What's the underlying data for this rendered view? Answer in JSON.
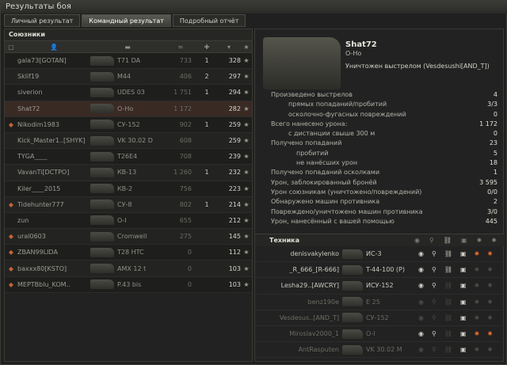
{
  "window": {
    "title": "Результаты боя"
  },
  "tabs": [
    "Личный результат",
    "Командный результат",
    "Подробный отчёт"
  ],
  "allies": {
    "title": "Союзники",
    "rows": [
      {
        "name": "gala73[GOTAN]",
        "vehicle": "T71 DA",
        "damage": "733",
        "kills": "1",
        "xp": "328"
      },
      {
        "name": "Sklif19",
        "vehicle": "M44",
        "damage": "406",
        "kills": "2",
        "xp": "297"
      },
      {
        "name": "siverion",
        "vehicle": "UDES 03",
        "damage": "1 751",
        "kills": "1",
        "xp": "294"
      },
      {
        "name": "Shat72",
        "vehicle": "O-Ho",
        "damage": "1 172",
        "kills": "",
        "xp": "282",
        "me": true
      },
      {
        "name": "Nikodim1983",
        "vehicle": "СУ-152",
        "damage": "902",
        "kills": "1",
        "xp": "259",
        "platoon": true
      },
      {
        "name": "Kick_Master1..[SHYK]",
        "vehicle": "VK 30.02 D",
        "damage": "608",
        "kills": "",
        "xp": "259"
      },
      {
        "name": "TYGA____",
        "vehicle": "T26E4",
        "damage": "708",
        "kills": "",
        "xp": "239"
      },
      {
        "name": "VavanTi[DCTPO]",
        "vehicle": "КВ-13",
        "damage": "1 260",
        "kills": "1",
        "xp": "232"
      },
      {
        "name": "Kiler____2015",
        "vehicle": "КВ-2",
        "damage": "756",
        "kills": "",
        "xp": "223"
      },
      {
        "name": "Tidehunter777",
        "vehicle": "СУ-8",
        "damage": "802",
        "kills": "1",
        "xp": "214",
        "platoon": true
      },
      {
        "name": "zun",
        "vehicle": "O-I",
        "damage": "655",
        "kills": "",
        "xp": "212"
      },
      {
        "name": "ural0603",
        "vehicle": "Cromwell",
        "damage": "275",
        "kills": "",
        "xp": "145",
        "platoon": true
      },
      {
        "name": "ZBAN99LIDA",
        "vehicle": "T28 HTC",
        "damage": "0",
        "kills": "",
        "xp": "112",
        "platoon": true
      },
      {
        "name": "baxxx80[KSTO]",
        "vehicle": "AMX 12 t",
        "damage": "0",
        "kills": "",
        "xp": "103",
        "platoon": true
      },
      {
        "name": "MEPTBblu_KOM..",
        "vehicle": "P.43 bis",
        "damage": "0",
        "kills": "",
        "xp": "103",
        "platoon": true
      }
    ]
  },
  "vehicle": {
    "name": "Shat72",
    "type": "O-Ho",
    "death": "Уничтожен выстрелом (Vesdesushi[AND_T])"
  },
  "stats": [
    {
      "label": "Произведено выстрелов",
      "value": "4",
      "indent": 0
    },
    {
      "label": "прямых попаданий/пробитий",
      "value": "3/3",
      "indent": 1
    },
    {
      "label": "осколочно-фугасных повреждений",
      "value": "0",
      "indent": 1
    },
    {
      "label": "Всего нанесено урона:",
      "value": "1 172",
      "indent": 0
    },
    {
      "label": "с дистанции свыше 300 м",
      "value": "0",
      "indent": 1
    },
    {
      "label": "Получено попаданий",
      "value": "23",
      "indent": 0
    },
    {
      "label": "пробитий",
      "value": "5",
      "indent": 2
    },
    {
      "label": "не нанёсших урон",
      "value": "18",
      "indent": 2
    },
    {
      "label": "Получено попаданий осколками",
      "value": "1",
      "indent": 0
    },
    {
      "label": "Урон, заблокированный бронёй",
      "value": "3 595",
      "indent": 0
    },
    {
      "label": "Урон союзникам (уничтожено/повреждений)",
      "value": "0/0",
      "indent": 0
    },
    {
      "label": "Обнаружено машин противника",
      "value": "2",
      "indent": 0
    },
    {
      "label": "Повреждено/уничтожено машин противника",
      "value": "3/0",
      "indent": 0
    },
    {
      "label": "Урон, нанесённый с вашей помощью",
      "value": "445",
      "indent": 0
    }
  ],
  "technique": {
    "title": "Техника",
    "rows": [
      {
        "player": "denisvakylenko",
        "vehicle": "ИС-3",
        "dim": false
      },
      {
        "player": "_R_666_[R-666]",
        "vehicle": "T-44-100 (P)",
        "dim": false
      },
      {
        "player": "Lesha29..[AWCRY]",
        "vehicle": "ИСУ-152",
        "dim": false
      },
      {
        "player": "benz190e",
        "vehicle": "E 25",
        "dim": true
      },
      {
        "player": "Vesdesus..[AND_T]",
        "vehicle": "СУ-152",
        "dim": true
      },
      {
        "player": "Miroslav2000_1",
        "vehicle": "O-I",
        "dim": true
      },
      {
        "player": "AntRasputen",
        "vehicle": "VK 30.02 M",
        "dim": true
      }
    ]
  }
}
